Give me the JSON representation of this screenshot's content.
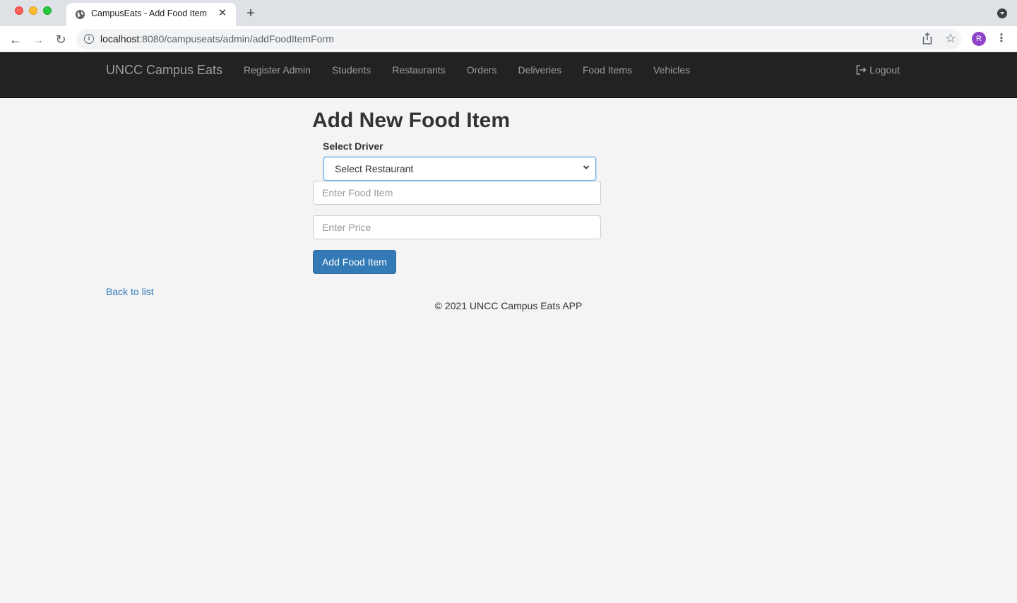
{
  "browser": {
    "tab_title": "CampusEats - Add Food Item",
    "url_host": "localhost",
    "url_path": ":8080/campuseats/admin/addFoodItemForm",
    "avatar_letter": "R"
  },
  "navbar": {
    "brand": "UNCC Campus Eats",
    "links": [
      "Register Admin",
      "Students",
      "Restaurants",
      "Orders",
      "Deliveries",
      "Food Items",
      "Vehicles"
    ],
    "logout_label": "Logout"
  },
  "form": {
    "title": "Add New Food Item",
    "select_label": "Select Driver",
    "select_value": "Select Restaurant",
    "food_item_placeholder": "Enter Food Item",
    "price_placeholder": "Enter Price",
    "submit_label": "Add Food Item"
  },
  "back_link": "Back to list",
  "footer": "© 2021 UNCC Campus Eats APP",
  "colors": {
    "navbar_bg": "#222222",
    "primary": "#337ab7",
    "page_bg": "#f4f4f4"
  }
}
